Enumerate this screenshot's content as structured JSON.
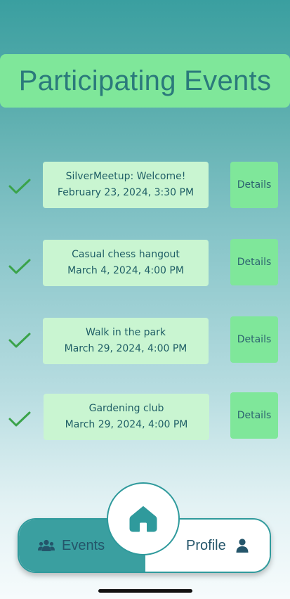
{
  "title": "Participating Events",
  "events": [
    {
      "name": "SilverMeetup: Welcome!",
      "datetime": "February 23, 2024, 3:30 PM",
      "button": "Details"
    },
    {
      "name": "Casual chess hangout",
      "datetime": "March 4, 2024, 4:00 PM",
      "button": "Details"
    },
    {
      "name": "Walk in the park",
      "datetime": "March 29, 2024, 4:00 PM",
      "button": "Details"
    },
    {
      "name": "Gardening club",
      "datetime": "March 29, 2024, 4:00 PM",
      "button": "Details"
    }
  ],
  "nav": {
    "events_label": "Events",
    "profile_label": "Profile",
    "icons": {
      "events": "group-icon",
      "home": "home-icon",
      "profile": "person-icon"
    }
  },
  "colors": {
    "accent_green": "#7fe79a",
    "card_green": "#c9f5d1",
    "teal": "#3a9fa0",
    "check_green": "#3aa34a",
    "text_dark_teal": "#1f5e66"
  }
}
